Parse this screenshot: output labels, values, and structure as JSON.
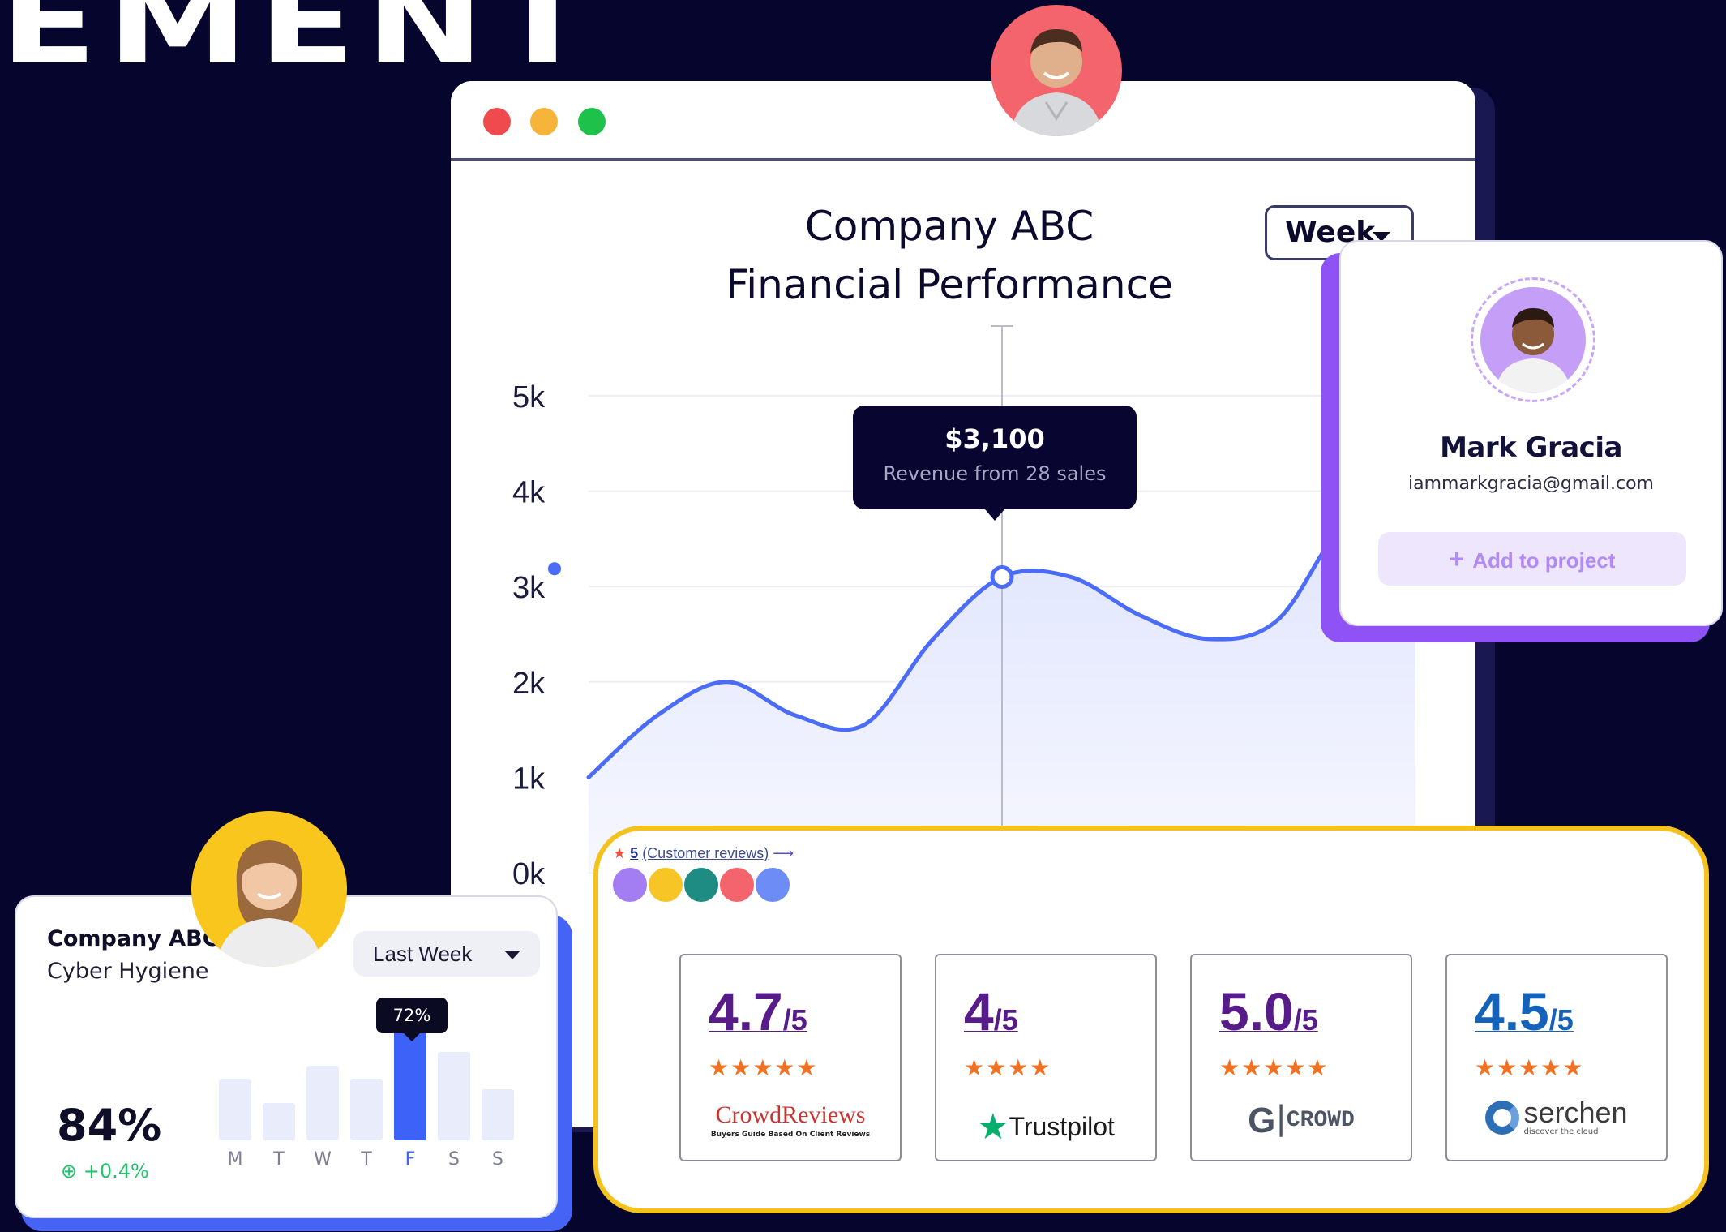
{
  "headline": "EMENT",
  "window": {
    "controls": [
      "close",
      "minimize",
      "maximize"
    ]
  },
  "chart": {
    "title_line1": "Company ABC",
    "title_line2": "Financial Performance",
    "period": "Week",
    "tooltip_amount": "$3,100",
    "tooltip_sub": "Revenue from 28 sales"
  },
  "chart_data": {
    "type": "area",
    "title": "Company ABC Financial Performance",
    "y_ticks": [
      "0k",
      "1k",
      "2k",
      "3k",
      "4k",
      "5k"
    ],
    "ylim": [
      0,
      5000
    ],
    "x": [
      0,
      1,
      2,
      3,
      4,
      5,
      6,
      7,
      8,
      9,
      10,
      11,
      12
    ],
    "values": [
      1000,
      1650,
      2000,
      1650,
      1550,
      2450,
      3100,
      3100,
      2700,
      2450,
      2650,
      3700,
      4000
    ],
    "highlight_index": 6,
    "grid": true,
    "color": "#4a6cf7"
  },
  "profile": {
    "name": "Mark Gracia",
    "email": "iammarkgracia@gmail.com",
    "action": "Add to project"
  },
  "cyber": {
    "company": "Company ABC",
    "subtitle": "Cyber Hygiene",
    "period": "Last Week",
    "percent": "84%",
    "delta": "+0.4%",
    "bar_tip": "72%",
    "days": [
      "M",
      "T",
      "W",
      "T",
      "F",
      "S",
      "S"
    ],
    "values": [
      0.36,
      0.22,
      0.44,
      0.36,
      0.66,
      0.52,
      0.3
    ],
    "active_index": 4
  },
  "reviews": {
    "count": "5",
    "link": "(Customer reviews)",
    "arrow": "⟶",
    "platforms": [
      {
        "score": "4.7",
        "out_of": "/5",
        "stars": "★★★★★",
        "logo_main": "CrowdReviews",
        "logo_sub": "Buyers Guide Based On Client Reviews",
        "color": "#571b8a"
      },
      {
        "score": "4",
        "out_of": "/5",
        "stars": "★★★★",
        "logo_main": "Trustpilot",
        "logo_sub": "",
        "color": "#571b8a"
      },
      {
        "score": "5.0",
        "out_of": "/5",
        "stars": "★★★★★",
        "logo_main": "CROWD",
        "logo_sub": "",
        "color": "#571b8a"
      },
      {
        "score": "4.5",
        "out_of": "/5",
        "stars": "★★★★★",
        "logo_main": "serchen",
        "logo_sub": "discover the cloud",
        "color": "#1462b9"
      }
    ]
  }
}
